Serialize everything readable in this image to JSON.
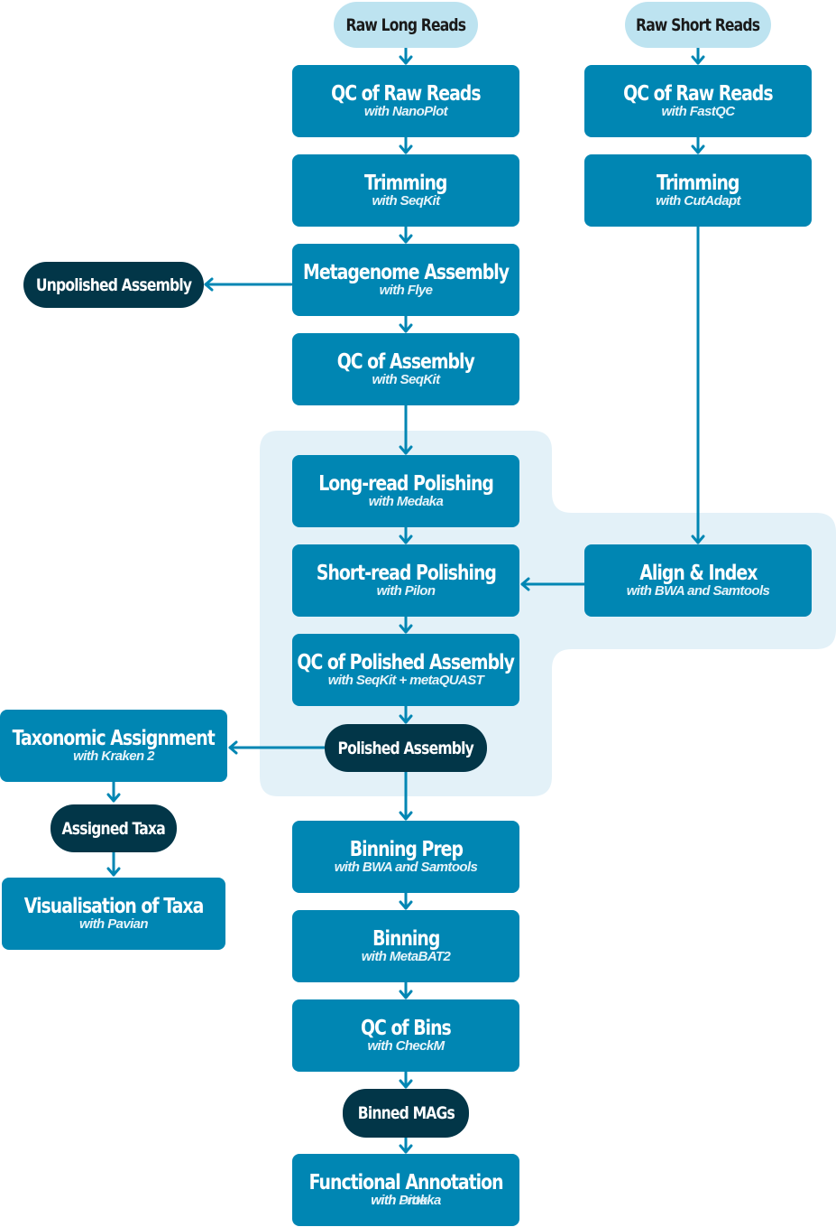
{
  "colors": {
    "step": "#0086b3",
    "input": "#bde3f0",
    "output": "#023648",
    "group": "#e3f1f8",
    "arrow": "#0086b3"
  },
  "inputs": {
    "long": "Raw Long Reads",
    "short": "Raw Short Reads"
  },
  "long_branch": [
    {
      "title": "QC of Raw Reads",
      "tool": "with NanoPlot"
    },
    {
      "title": "Trimming",
      "tool": "with SeqKit"
    },
    {
      "title": "Metagenome Assembly",
      "tool": "with Flye"
    },
    {
      "title": "QC of Assembly",
      "tool": "with SeqKit"
    }
  ],
  "short_branch": [
    {
      "title": "QC of Raw Reads",
      "tool": "with FastQC"
    },
    {
      "title": "Trimming",
      "tool": "with CutAdapt"
    }
  ],
  "polishing": [
    {
      "title": "Long-read Polishing",
      "tool": "with Medaka"
    },
    {
      "title": "Short-read Polishing",
      "tool": "with Pilon"
    },
    {
      "title": "QC of Polished Assembly",
      "tool": "with SeqKit + metaQUAST"
    }
  ],
  "align": {
    "title": "Align & Index",
    "tool": "with BWA and Samtools"
  },
  "outputs": {
    "unpolished": "Unpolished Assembly",
    "polished": "Polished Assembly",
    "taxa": "Assigned Taxa",
    "mags": "Binned MAGs"
  },
  "taxonomy": [
    {
      "title": "Taxonomic Assignment",
      "tool": "with Kraken 2"
    },
    {
      "title": "Visualisation of Taxa",
      "tool": "with Pavian"
    }
  ],
  "binning": [
    {
      "title": "Binning Prep",
      "tool": "with BWA and Samtools"
    },
    {
      "title": "Binning",
      "tool": "with MetaBAT2"
    },
    {
      "title": "QC of Bins",
      "tool": "with CheckM"
    }
  ],
  "annotation": {
    "title": "Functional Annotation",
    "tool": "with Prokka",
    "tool_overlap": "with Ditto"
  }
}
